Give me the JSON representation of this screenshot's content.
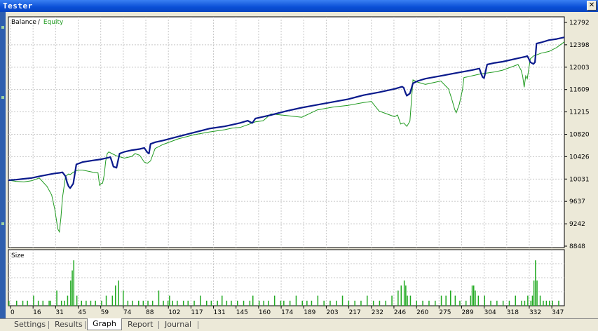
{
  "window": {
    "title": "Tester",
    "close_glyph": "✕"
  },
  "tabs": [
    {
      "label": "Settings",
      "active": false
    },
    {
      "label": "Results",
      "active": false
    },
    {
      "label": "Graph",
      "active": true
    },
    {
      "label": "Report",
      "active": false
    },
    {
      "label": "Journal",
      "active": false
    }
  ],
  "colors": {
    "balance": "#0a1a8c",
    "equity": "#1f9a1f",
    "size_bars": "#22aa22",
    "grid": "#c8c8c8"
  },
  "chart_data": [
    {
      "type": "line",
      "legend": {
        "balance": "Balance",
        "separator": "/",
        "equity": "Equity"
      },
      "ylim": [
        8848,
        12792
      ],
      "y_ticks": [
        12792,
        12398,
        12003,
        11609,
        11215,
        10820,
        10426,
        10031,
        9637,
        9242,
        8848
      ],
      "x_ticks": [
        "0",
        "16",
        "31",
        "45",
        "59",
        "74",
        "88",
        "102",
        "117",
        "131",
        "145",
        "160",
        "174",
        "189",
        "203",
        "217",
        "232",
        "246",
        "260",
        "275",
        "289",
        "304",
        "318",
        "332",
        "347"
      ],
      "xlim": [
        0,
        360
      ],
      "grid": true,
      "series": [
        {
          "name": "Balance",
          "x": [
            0,
            5,
            10,
            15,
            20,
            25,
            28,
            30,
            33,
            35,
            37,
            38,
            39,
            40,
            42,
            44,
            46,
            48,
            55,
            60,
            65,
            66,
            67,
            68,
            70,
            72,
            75,
            80,
            85,
            88,
            89,
            90,
            91,
            92,
            95,
            100,
            110,
            120,
            130,
            140,
            145,
            150,
            155,
            157,
            158,
            160,
            170,
            180,
            190,
            200,
            210,
            220,
            230,
            240,
            245,
            250,
            255,
            256,
            257,
            258,
            260,
            262,
            265,
            270,
            280,
            290,
            300,
            305,
            306,
            307,
            308,
            310,
            315,
            320,
            330,
            335,
            336,
            337,
            338,
            340,
            341,
            342,
            345,
            350,
            355,
            360
          ],
          "y": [
            10010,
            10020,
            10035,
            10050,
            10080,
            10105,
            10120,
            10130,
            10140,
            10150,
            10080,
            9970,
            9900,
            9870,
            9950,
            10290,
            10310,
            10330,
            10360,
            10380,
            10410,
            10420,
            10340,
            10250,
            10230,
            10480,
            10510,
            10540,
            10560,
            10580,
            10540,
            10500,
            10480,
            10650,
            10680,
            10710,
            10780,
            10850,
            10920,
            10960,
            10990,
            11020,
            11060,
            11030,
            11020,
            11100,
            11160,
            11230,
            11290,
            11340,
            11390,
            11440,
            11510,
            11560,
            11590,
            11620,
            11660,
            11640,
            11560,
            11500,
            11540,
            11720,
            11760,
            11800,
            11850,
            11900,
            11950,
            11980,
            11900,
            11830,
            11810,
            12050,
            12080,
            12100,
            12160,
            12190,
            12200,
            12150,
            12090,
            12060,
            12090,
            12420,
            12440,
            12480,
            12500,
            12530
          ]
        },
        {
          "name": "Equity",
          "x": [
            0,
            5,
            10,
            15,
            20,
            25,
            28,
            30,
            32,
            33,
            34,
            35,
            37,
            38,
            39,
            40,
            42,
            44,
            46,
            48,
            55,
            58,
            59,
            60,
            61,
            62,
            63,
            64,
            65,
            67,
            70,
            75,
            80,
            82,
            85,
            88,
            90,
            92,
            95,
            100,
            110,
            120,
            130,
            140,
            145,
            150,
            155,
            160,
            165,
            170,
            180,
            190,
            200,
            210,
            220,
            230,
            235,
            240,
            245,
            250,
            252,
            254,
            256,
            258,
            260,
            262,
            265,
            270,
            280,
            285,
            287,
            289,
            290,
            292,
            294,
            295,
            297,
            300,
            305,
            310,
            315,
            320,
            330,
            332,
            333,
            334,
            335,
            336,
            338,
            340,
            345,
            350,
            355,
            360
          ],
          "y": [
            10010,
            9990,
            9980,
            10000,
            10050,
            9900,
            9750,
            9500,
            9150,
            9100,
            9350,
            9700,
            10080,
            10100,
            10120,
            10110,
            10150,
            10180,
            10190,
            10190,
            10150,
            10140,
            9920,
            9950,
            9960,
            10100,
            10350,
            10480,
            10510,
            10480,
            10440,
            10400,
            10430,
            10480,
            10450,
            10330,
            10310,
            10350,
            10570,
            10640,
            10740,
            10810,
            10860,
            10900,
            10930,
            10940,
            10990,
            11040,
            11060,
            11180,
            11150,
            11120,
            11250,
            11300,
            11330,
            11380,
            11400,
            11230,
            11180,
            11130,
            11160,
            11000,
            11020,
            10960,
            11050,
            11780,
            11740,
            11700,
            11760,
            11620,
            11450,
            11260,
            11200,
            11350,
            11600,
            11820,
            11830,
            11850,
            11880,
            11900,
            11920,
            11950,
            12050,
            11950,
            11850,
            11650,
            11850,
            11800,
            12150,
            12200,
            12250,
            12280,
            12350,
            12450
          ]
        }
      ]
    },
    {
      "type": "bar",
      "title": "Size",
      "ylim": [
        0,
        10
      ],
      "grid": true,
      "x": [
        0,
        5,
        9,
        12,
        16,
        19,
        22,
        26,
        27,
        31,
        34,
        36,
        38,
        40,
        41,
        42,
        44,
        47,
        50,
        53,
        56,
        60,
        63,
        67,
        69,
        71,
        74,
        77,
        80,
        84,
        87,
        90,
        93,
        97,
        100,
        103,
        104,
        106,
        109,
        113,
        116,
        120,
        124,
        128,
        131,
        135,
        138,
        141,
        144,
        148,
        152,
        156,
        158,
        162,
        165,
        168,
        172,
        176,
        178,
        182,
        186,
        190,
        193,
        196,
        200,
        204,
        208,
        212,
        216,
        220,
        224,
        228,
        232,
        236,
        240,
        244,
        248,
        252,
        254,
        256,
        257,
        258,
        260,
        264,
        268,
        272,
        276,
        280,
        283,
        286,
        289,
        292,
        296,
        299,
        300,
        301,
        302,
        304,
        308,
        312,
        316,
        320,
        324,
        328,
        332,
        334,
        336,
        338,
        339,
        340,
        341,
        342,
        344,
        346,
        348,
        350,
        352,
        356
      ],
      "values": [
        1,
        1,
        1,
        1,
        2,
        1,
        1,
        1,
        1,
        3,
        1,
        1,
        2,
        5,
        7,
        9,
        2,
        1,
        1,
        1,
        1,
        1,
        2,
        2,
        4,
        5,
        3,
        1,
        1,
        1,
        1,
        1,
        1,
        3,
        1,
        1,
        2,
        1,
        1,
        1,
        1,
        1,
        2,
        1,
        1,
        1,
        2,
        1,
        1,
        1,
        1,
        1,
        2,
        1,
        1,
        1,
        2,
        1,
        1,
        1,
        2,
        1,
        1,
        1,
        2,
        1,
        1,
        1,
        2,
        1,
        1,
        1,
        2,
        1,
        1,
        1,
        2,
        3,
        4,
        5,
        4,
        2,
        2,
        1,
        1,
        1,
        1,
        2,
        2,
        3,
        2,
        1,
        1,
        2,
        4,
        4,
        3,
        2,
        2,
        1,
        1,
        1,
        1,
        2,
        1,
        1,
        2,
        1,
        2,
        5,
        9,
        5,
        2,
        1,
        1,
        1,
        1,
        1,
        1
      ]
    }
  ]
}
